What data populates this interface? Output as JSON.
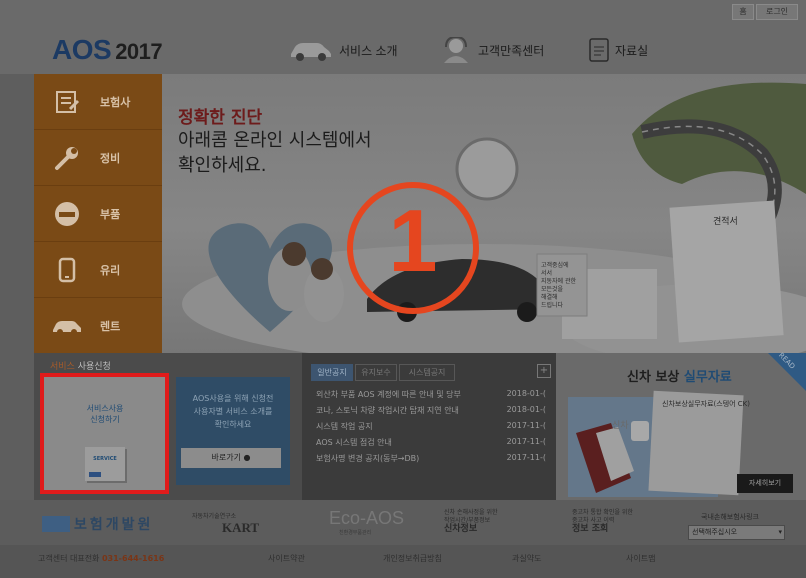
{
  "header": {
    "top_links": [
      "홈",
      "로그인"
    ],
    "logo": "AOS",
    "logo_year": "2017",
    "nav": [
      {
        "label": "서비스 소개",
        "icon": "car-icon"
      },
      {
        "label": "고객만족센터",
        "icon": "support-agent-icon"
      },
      {
        "label": "자료실",
        "icon": "document-icon"
      }
    ]
  },
  "left_menu": [
    {
      "label": "보험사",
      "icon": "insurance-doc-icon"
    },
    {
      "label": "정비",
      "icon": "wrench-icon"
    },
    {
      "label": "부품",
      "icon": "part-icon"
    },
    {
      "label": "유리",
      "icon": "glass-icon"
    },
    {
      "label": "렌트",
      "icon": "rental-car-icon"
    }
  ],
  "hero": {
    "line1": "정확한 진단",
    "line2": "아래콤 온라인 시스템에서",
    "line3": "확인하세요.",
    "marker": "①",
    "estimate_title": "견적서",
    "side_text": [
      "고객중심에",
      "서서",
      "지동자에 관한",
      "모든것을",
      "해결해",
      "드립니다"
    ]
  },
  "service_apply": {
    "title_prefix": "서비스",
    "title": "사용신청",
    "card_line1": "서비스사용",
    "card_line2": "신청하기",
    "card_badge": "SERVICE",
    "desc": [
      "AOS사용을 위해 신청전",
      "사용자별 서비스 소개를",
      "확인하세요"
    ],
    "go_button": "바로가기"
  },
  "notices": {
    "tabs": [
      "일반공지",
      "유지보수",
      "시스템공지"
    ],
    "plus": "+",
    "items": [
      {
        "title": "외산차 부품 AOS 계정에 따른 안내 및 당부",
        "date": "2018-01-("
      },
      {
        "title": "코나, 스토닉 차량 작업시간 탑재 지연 안내",
        "date": "2018-01-("
      },
      {
        "title": "시스템 작업 공지",
        "date": "2017-11-("
      },
      {
        "title": "AOS 시스템 점검 안내",
        "date": "2017-11-("
      },
      {
        "title": "보험사명 변경 공지(동부→DB)",
        "date": "2017-11-("
      }
    ]
  },
  "new_car": {
    "title": "신차 보상",
    "title_accent": "실무자료",
    "corner": "READ",
    "doc_text": "신차보상실무자료(스텡어 CK)",
    "book_text": "신차",
    "detail_button": "자세히보기"
  },
  "partners": {
    "p1": "보험개발원",
    "p2_small": "자동차기술연구소",
    "p2": "KART",
    "p3": "Eco-AOS",
    "p3_sub": "친환경부품관리",
    "p4_l1": "신차 손해사정을 위한",
    "p4_l2": "작업시간/부품정보",
    "p4_l3": "신차정보",
    "p5_l1": "중고차 통합 확인을 위한",
    "p5_l2": "중고차 사고 이력",
    "p5_l3": "정보 조회",
    "insurer_label": "국내손해보험사링크",
    "insurer_select": "선택해주십시오"
  },
  "footer": {
    "phone_label": "고객센터 대표전화",
    "phone": "031-644-1616",
    "links": [
      "사이트약관",
      "개인정보취급방침",
      "과실약도",
      "사이트맵"
    ]
  }
}
